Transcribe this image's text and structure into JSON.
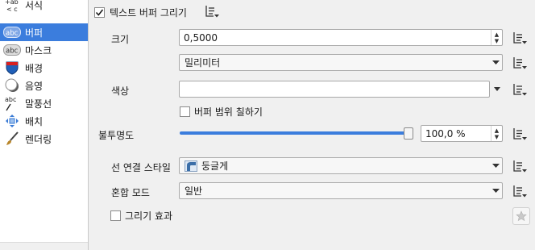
{
  "sidebar": {
    "items": [
      {
        "label": "서식",
        "icon": "text-format-icon"
      },
      {
        "label": "버퍼",
        "icon": "text-buffer-icon"
      },
      {
        "label": "마스크",
        "icon": "text-mask-icon"
      },
      {
        "label": "배경",
        "icon": "background-shield-icon"
      },
      {
        "label": "음영",
        "icon": "shadow-icon"
      },
      {
        "label": "말풍선",
        "icon": "callout-icon"
      },
      {
        "label": "배치",
        "icon": "placement-icon"
      },
      {
        "label": "렌더링",
        "icon": "rendering-brush-icon"
      }
    ],
    "selected_index": 1
  },
  "buffer": {
    "draw_label": "텍스트 버퍼 그리기",
    "draw_checked": true,
    "size_label": "크기",
    "size_value": "0,5000",
    "unit_value": "밀리미터",
    "color_label": "색상",
    "fill_label": "버퍼 범위 칠하기",
    "fill_checked": false,
    "opacity_label": "불투명도",
    "opacity_value": "100,0 %",
    "opacity_percent": 100,
    "join_label": "선 연결 스타일",
    "join_value": "둥글게",
    "blend_label": "혼합 모드",
    "blend_value": "일반",
    "effects_label": "그리기 효과",
    "effects_checked": false
  },
  "colors": {
    "accent": "#3b7ddd",
    "selected_text": "#ffffff"
  }
}
